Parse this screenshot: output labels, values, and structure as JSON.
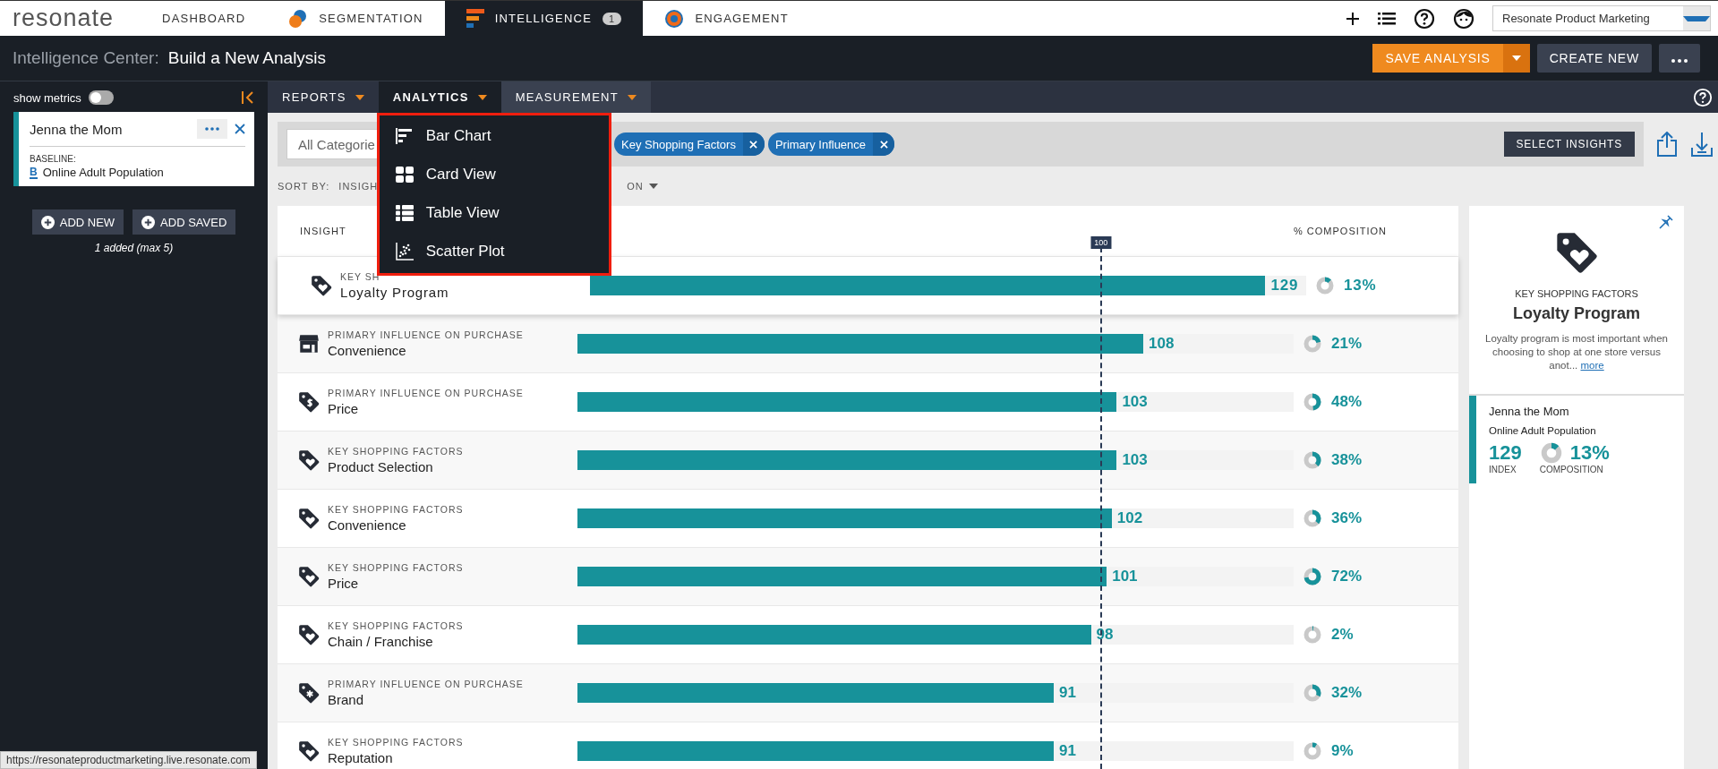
{
  "top_nav": {
    "logo": "resonate",
    "tabs": [
      {
        "label": "DASHBOARD",
        "selected": false
      },
      {
        "label": "SEGMENTATION",
        "selected": false
      },
      {
        "label": "INTELLIGENCE",
        "selected": true,
        "badge": "1"
      },
      {
        "label": "ENGAGEMENT",
        "selected": false
      }
    ],
    "account": "Resonate Product Marketing"
  },
  "header": {
    "section": "Intelligence Center:",
    "title": "Build a New Analysis",
    "save_button": "SAVE ANALYSIS",
    "create_button": "CREATE NEW"
  },
  "sidebar": {
    "toggle": {
      "label": "show metrics",
      "on": false
    },
    "audiences": [
      {
        "name": "Jenna the Mom",
        "baseline_label": "BASELINE:",
        "baseline_marker": "B",
        "baseline": "Online Adult Population"
      }
    ],
    "add_new": "ADD NEW",
    "add_saved": "ADD SAVED",
    "count": "1 added (max 5)"
  },
  "sub_tabs": [
    {
      "label": "REPORTS",
      "selected": false
    },
    {
      "label": "ANALYTICS",
      "selected": true
    },
    {
      "label": "MEASUREMENT",
      "selected": false
    }
  ],
  "menu": {
    "items": [
      "Bar Chart",
      "Card View",
      "Table View",
      "Scatter Plot"
    ]
  },
  "filters": {
    "category": "All Categorie",
    "chips": [
      "Key Shopping Factors",
      "Primary Influence"
    ],
    "select_button": "SELECT INSIGHTS"
  },
  "sort": {
    "label": "SORT BY:",
    "options": [
      "INSIGH",
      "ON"
    ]
  },
  "table": {
    "columns": [
      "INSIGHT",
      "% COMPOSITION"
    ],
    "baseline": {
      "label": "100"
    },
    "rows": [
      {
        "category": "KEY SH",
        "name": "Loyalty Program",
        "index": "129",
        "level": 0.943,
        "composition": {
          "text": "13%",
          "level": 0.13
        },
        "selected": true
      },
      {
        "category": "PRIMARY INFLUENCE ON PURCHASE",
        "name": "Convenience",
        "index": "108",
        "level": 0.79,
        "composition": {
          "text": "21%",
          "level": 0.21
        },
        "selected": false
      },
      {
        "category": "PRIMARY INFLUENCE ON PURCHASE",
        "name": "Price",
        "index": "103",
        "level": 0.753,
        "composition": {
          "text": "48%",
          "level": 0.48
        },
        "selected": false
      },
      {
        "category": "KEY SHOPPING FACTORS",
        "name": "Product Selection",
        "index": "103",
        "level": 0.753,
        "composition": {
          "text": "38%",
          "level": 0.38
        },
        "selected": false
      },
      {
        "category": "KEY SHOPPING FACTORS",
        "name": "Convenience",
        "index": "102",
        "level": 0.746,
        "composition": {
          "text": "36%",
          "level": 0.36
        },
        "selected": false
      },
      {
        "category": "KEY SHOPPING FACTORS",
        "name": "Price",
        "index": "101",
        "level": 0.739,
        "composition": {
          "text": "72%",
          "level": 0.72
        },
        "selected": false
      },
      {
        "category": "KEY SHOPPING FACTORS",
        "name": "Chain / Franchise",
        "index": "98",
        "level": 0.717,
        "composition": {
          "text": "2%",
          "level": 0.02
        },
        "selected": false
      },
      {
        "category": "PRIMARY INFLUENCE ON PURCHASE",
        "name": "Brand",
        "index": "91",
        "level": 0.665,
        "composition": {
          "text": "32%",
          "level": 0.32
        },
        "selected": false
      },
      {
        "category": "KEY SHOPPING FACTORS",
        "name": "Reputation",
        "index": "91",
        "level": 0.665,
        "composition": {
          "text": "9%",
          "level": 0.09
        },
        "selected": false
      }
    ]
  },
  "detail": {
    "category": "KEY SHOPPING FACTORS",
    "title": "Loyalty Program",
    "description": "Loyalty program is most important when choosing to shop at one store versus anot...",
    "more_link": "more",
    "audience": "Jenna the Mom",
    "baseline": "Online Adult Population",
    "index": "129",
    "index_label": "INDEX",
    "composition": {
      "text": "13%",
      "level": 0.13
    },
    "composition_label": "COMPOSITION"
  },
  "status_url": "https://resonateproductmarketing.live.resonate.com"
}
